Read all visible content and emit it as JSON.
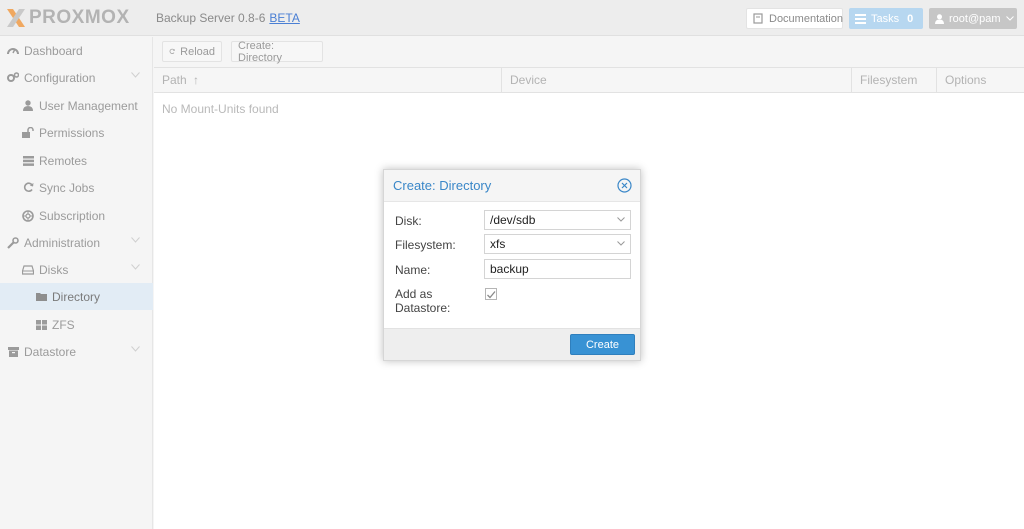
{
  "header": {
    "brand": "PROXMOX",
    "product": "Backup Server 0.8-6",
    "beta_label": "BETA",
    "documentation_label": "Documentation",
    "tasks_label": "Tasks",
    "tasks_count": "0",
    "user_label": "root@pam"
  },
  "sidebar": {
    "items": [
      {
        "label": "Dashboard",
        "icon": "dashboard-icon"
      },
      {
        "label": "Configuration",
        "icon": "cogs-icon",
        "expandable": true
      },
      {
        "label": "User Management",
        "icon": "user-icon"
      },
      {
        "label": "Permissions",
        "icon": "unlock-icon"
      },
      {
        "label": "Remotes",
        "icon": "server-icon"
      },
      {
        "label": "Sync Jobs",
        "icon": "refresh-icon"
      },
      {
        "label": "Subscription",
        "icon": "life-ring-icon"
      },
      {
        "label": "Administration",
        "icon": "wrench-icon",
        "expandable": true
      },
      {
        "label": "Disks",
        "icon": "hdd-icon",
        "expandable": true
      },
      {
        "label": "Directory",
        "icon": "folder-icon",
        "selected": true
      },
      {
        "label": "ZFS",
        "icon": "th-large-icon"
      },
      {
        "label": "Datastore",
        "icon": "archive-icon",
        "expandable": true
      }
    ]
  },
  "toolbar": {
    "reload_label": "Reload",
    "create_directory_label": "Create: Directory"
  },
  "grid": {
    "columns": [
      "Path",
      "Device",
      "Filesystem",
      "Options"
    ],
    "sort_indicator": "↑",
    "empty_text": "No Mount-Units found"
  },
  "dialog": {
    "title": "Create: Directory",
    "disk_label": "Disk:",
    "disk_value": "/dev/sdb",
    "filesystem_label": "Filesystem:",
    "filesystem_value": "xfs",
    "name_label": "Name:",
    "name_value": "backup",
    "add_datastore_label_1": "Add as",
    "add_datastore_label_2": "Datastore:",
    "add_datastore_checked": true,
    "create_label": "Create"
  },
  "colors": {
    "accent": "#3892d4",
    "title_blue": "#3a87c8",
    "tasks_bg": "#b7d7f0",
    "selected_row": "#e2ecf5"
  }
}
